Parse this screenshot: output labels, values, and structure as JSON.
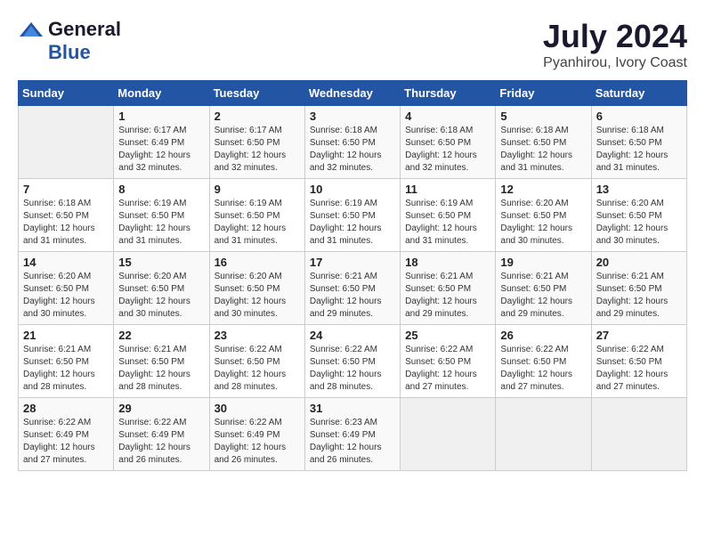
{
  "header": {
    "logo_general": "General",
    "logo_blue": "Blue",
    "month": "July 2024",
    "location": "Pyanhirou, Ivory Coast"
  },
  "days_of_week": [
    "Sunday",
    "Monday",
    "Tuesday",
    "Wednesday",
    "Thursday",
    "Friday",
    "Saturday"
  ],
  "weeks": [
    [
      {
        "day": "",
        "sunrise": "",
        "sunset": "",
        "daylight": ""
      },
      {
        "day": "1",
        "sunrise": "Sunrise: 6:17 AM",
        "sunset": "Sunset: 6:49 PM",
        "daylight": "Daylight: 12 hours and 32 minutes."
      },
      {
        "day": "2",
        "sunrise": "Sunrise: 6:17 AM",
        "sunset": "Sunset: 6:50 PM",
        "daylight": "Daylight: 12 hours and 32 minutes."
      },
      {
        "day": "3",
        "sunrise": "Sunrise: 6:18 AM",
        "sunset": "Sunset: 6:50 PM",
        "daylight": "Daylight: 12 hours and 32 minutes."
      },
      {
        "day": "4",
        "sunrise": "Sunrise: 6:18 AM",
        "sunset": "Sunset: 6:50 PM",
        "daylight": "Daylight: 12 hours and 32 minutes."
      },
      {
        "day": "5",
        "sunrise": "Sunrise: 6:18 AM",
        "sunset": "Sunset: 6:50 PM",
        "daylight": "Daylight: 12 hours and 31 minutes."
      },
      {
        "day": "6",
        "sunrise": "Sunrise: 6:18 AM",
        "sunset": "Sunset: 6:50 PM",
        "daylight": "Daylight: 12 hours and 31 minutes."
      }
    ],
    [
      {
        "day": "7",
        "sunrise": "Sunrise: 6:18 AM",
        "sunset": "Sunset: 6:50 PM",
        "daylight": "Daylight: 12 hours and 31 minutes."
      },
      {
        "day": "8",
        "sunrise": "Sunrise: 6:19 AM",
        "sunset": "Sunset: 6:50 PM",
        "daylight": "Daylight: 12 hours and 31 minutes."
      },
      {
        "day": "9",
        "sunrise": "Sunrise: 6:19 AM",
        "sunset": "Sunset: 6:50 PM",
        "daylight": "Daylight: 12 hours and 31 minutes."
      },
      {
        "day": "10",
        "sunrise": "Sunrise: 6:19 AM",
        "sunset": "Sunset: 6:50 PM",
        "daylight": "Daylight: 12 hours and 31 minutes."
      },
      {
        "day": "11",
        "sunrise": "Sunrise: 6:19 AM",
        "sunset": "Sunset: 6:50 PM",
        "daylight": "Daylight: 12 hours and 31 minutes."
      },
      {
        "day": "12",
        "sunrise": "Sunrise: 6:20 AM",
        "sunset": "Sunset: 6:50 PM",
        "daylight": "Daylight: 12 hours and 30 minutes."
      },
      {
        "day": "13",
        "sunrise": "Sunrise: 6:20 AM",
        "sunset": "Sunset: 6:50 PM",
        "daylight": "Daylight: 12 hours and 30 minutes."
      }
    ],
    [
      {
        "day": "14",
        "sunrise": "Sunrise: 6:20 AM",
        "sunset": "Sunset: 6:50 PM",
        "daylight": "Daylight: 12 hours and 30 minutes."
      },
      {
        "day": "15",
        "sunrise": "Sunrise: 6:20 AM",
        "sunset": "Sunset: 6:50 PM",
        "daylight": "Daylight: 12 hours and 30 minutes."
      },
      {
        "day": "16",
        "sunrise": "Sunrise: 6:20 AM",
        "sunset": "Sunset: 6:50 PM",
        "daylight": "Daylight: 12 hours and 30 minutes."
      },
      {
        "day": "17",
        "sunrise": "Sunrise: 6:21 AM",
        "sunset": "Sunset: 6:50 PM",
        "daylight": "Daylight: 12 hours and 29 minutes."
      },
      {
        "day": "18",
        "sunrise": "Sunrise: 6:21 AM",
        "sunset": "Sunset: 6:50 PM",
        "daylight": "Daylight: 12 hours and 29 minutes."
      },
      {
        "day": "19",
        "sunrise": "Sunrise: 6:21 AM",
        "sunset": "Sunset: 6:50 PM",
        "daylight": "Daylight: 12 hours and 29 minutes."
      },
      {
        "day": "20",
        "sunrise": "Sunrise: 6:21 AM",
        "sunset": "Sunset: 6:50 PM",
        "daylight": "Daylight: 12 hours and 29 minutes."
      }
    ],
    [
      {
        "day": "21",
        "sunrise": "Sunrise: 6:21 AM",
        "sunset": "Sunset: 6:50 PM",
        "daylight": "Daylight: 12 hours and 28 minutes."
      },
      {
        "day": "22",
        "sunrise": "Sunrise: 6:21 AM",
        "sunset": "Sunset: 6:50 PM",
        "daylight": "Daylight: 12 hours and 28 minutes."
      },
      {
        "day": "23",
        "sunrise": "Sunrise: 6:22 AM",
        "sunset": "Sunset: 6:50 PM",
        "daylight": "Daylight: 12 hours and 28 minutes."
      },
      {
        "day": "24",
        "sunrise": "Sunrise: 6:22 AM",
        "sunset": "Sunset: 6:50 PM",
        "daylight": "Daylight: 12 hours and 28 minutes."
      },
      {
        "day": "25",
        "sunrise": "Sunrise: 6:22 AM",
        "sunset": "Sunset: 6:50 PM",
        "daylight": "Daylight: 12 hours and 27 minutes."
      },
      {
        "day": "26",
        "sunrise": "Sunrise: 6:22 AM",
        "sunset": "Sunset: 6:50 PM",
        "daylight": "Daylight: 12 hours and 27 minutes."
      },
      {
        "day": "27",
        "sunrise": "Sunrise: 6:22 AM",
        "sunset": "Sunset: 6:50 PM",
        "daylight": "Daylight: 12 hours and 27 minutes."
      }
    ],
    [
      {
        "day": "28",
        "sunrise": "Sunrise: 6:22 AM",
        "sunset": "Sunset: 6:49 PM",
        "daylight": "Daylight: 12 hours and 27 minutes."
      },
      {
        "day": "29",
        "sunrise": "Sunrise: 6:22 AM",
        "sunset": "Sunset: 6:49 PM",
        "daylight": "Daylight: 12 hours and 26 minutes."
      },
      {
        "day": "30",
        "sunrise": "Sunrise: 6:22 AM",
        "sunset": "Sunset: 6:49 PM",
        "daylight": "Daylight: 12 hours and 26 minutes."
      },
      {
        "day": "31",
        "sunrise": "Sunrise: 6:23 AM",
        "sunset": "Sunset: 6:49 PM",
        "daylight": "Daylight: 12 hours and 26 minutes."
      },
      {
        "day": "",
        "sunrise": "",
        "sunset": "",
        "daylight": ""
      },
      {
        "day": "",
        "sunrise": "",
        "sunset": "",
        "daylight": ""
      },
      {
        "day": "",
        "sunrise": "",
        "sunset": "",
        "daylight": ""
      }
    ]
  ]
}
